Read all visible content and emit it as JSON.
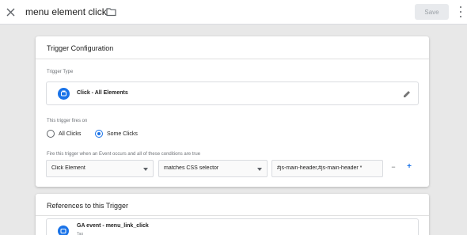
{
  "header": {
    "title": "menu element click",
    "save_label": "Save",
    "icons": {
      "close": "close-icon",
      "folder": "folder-icon",
      "more": "more-vert-icon"
    }
  },
  "config": {
    "title": "Trigger Configuration",
    "trigger_type_label": "Trigger Type",
    "trigger_type_value": "Click - All Elements",
    "fires_on_label": "This trigger fires on",
    "options": [
      "All Clicks",
      "Some Clicks"
    ],
    "selected_option": "Some Clicks",
    "condition_label": "Fire this trigger when an Event occurs and all of these conditions are true",
    "condition": {
      "variable": "Click Element",
      "operator": "matches CSS selector",
      "value": "#js-main-header,#js-main-header *"
    },
    "remove_label": "−",
    "add_label": "+"
  },
  "references": {
    "title": "References to this Trigger",
    "items": [
      {
        "name": "GA event - menu_link_click",
        "type": "Tag"
      }
    ]
  },
  "colors": {
    "accent": "#1a73e8",
    "background": "#e8e8e8"
  }
}
